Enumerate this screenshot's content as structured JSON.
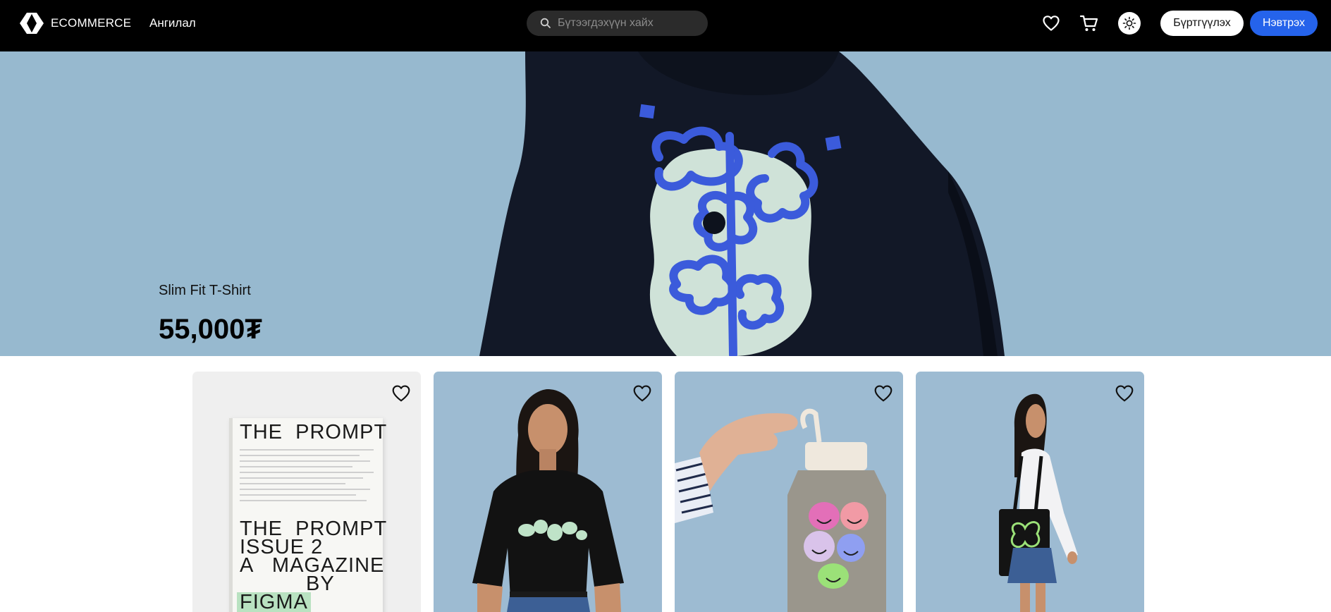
{
  "header": {
    "brand": "ECOMMERCE",
    "category_label": "Ангилал",
    "search_placeholder": "Бүтээгдэхүүн хайх",
    "register_label": "Бүртгүүлэх",
    "login_label": "Нэвтрэх",
    "icons": [
      "brand-logo-icon",
      "search-icon",
      "heart-icon",
      "cart-icon",
      "sun-icon"
    ]
  },
  "hero": {
    "product_name": "Slim Fit T-Shirt",
    "price": "55,000₮",
    "image": "black hoodie with flower print on blue background"
  },
  "products": [
    {
      "image": "magazine",
      "cover_lines": [
        "THE  PROMPT",
        "THE  PROMPT",
        "ISSUE 2",
        "A   MAGAZINE",
        "BY",
        "FIGMA"
      ]
    },
    {
      "image": "black t-shirt on model"
    },
    {
      "image": "water bottle with smiley stickers"
    },
    {
      "image": "black tote bag on model"
    }
  ],
  "colors": {
    "header_bg": "#000000",
    "accent": "#2563eb",
    "hero_bg": "#97b9cf",
    "card_blue": "#9dbbd2"
  }
}
